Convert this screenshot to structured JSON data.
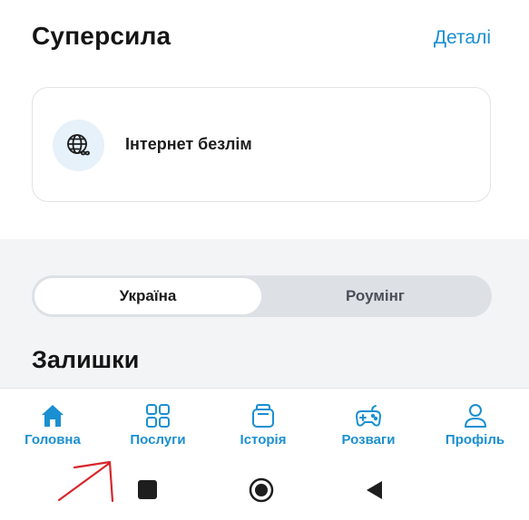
{
  "header": {
    "title": "Суперсила",
    "details_link": "Деталі"
  },
  "feature_card": {
    "icon": "globe-infinity-icon",
    "label": "Інтернет безлім"
  },
  "segmented": {
    "active": "Україна",
    "inactive": "Роумінг"
  },
  "balances": {
    "title": "Залишки"
  },
  "tabs": [
    {
      "label": "Головна",
      "icon": "home-icon"
    },
    {
      "label": "Послуги",
      "icon": "grid-icon"
    },
    {
      "label": "Історія",
      "icon": "box-icon"
    },
    {
      "label": "Розваги",
      "icon": "gamepad-icon"
    },
    {
      "label": "Профіль",
      "icon": "person-icon"
    }
  ],
  "colors": {
    "accent": "#1a8fd1",
    "card_border": "#e1e4e8",
    "section_bg": "#f3f4f6",
    "annotation_arrow": "#d7262b"
  }
}
